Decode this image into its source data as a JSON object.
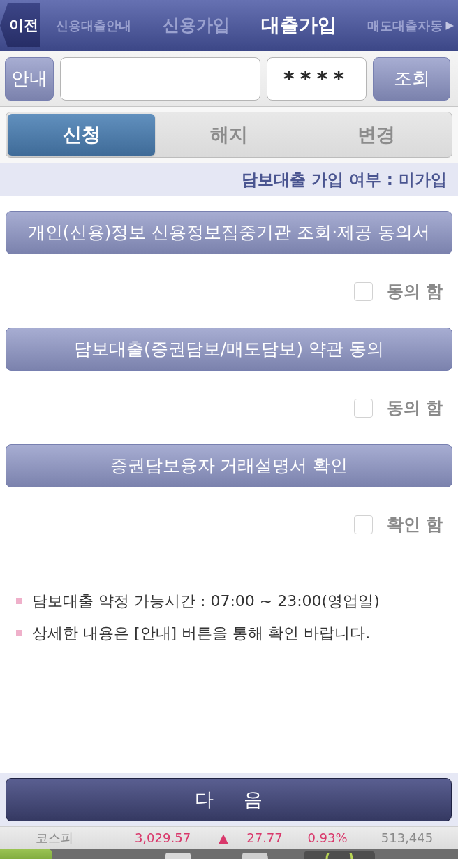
{
  "header": {
    "back_button": "이전",
    "tabs": [
      {
        "label": "신용대출안내",
        "selected": false
      },
      {
        "label": "신용가입",
        "selected": false
      },
      {
        "label": "대출가입",
        "selected": true
      },
      {
        "label": "매도대출자동",
        "selected": false
      }
    ],
    "more_arrow": "▶"
  },
  "lookup": {
    "info_button": "안내",
    "password_field": {
      "value": "****"
    },
    "search_button": "조회"
  },
  "segments": [
    {
      "label": "신청",
      "selected": true
    },
    {
      "label": "해지",
      "selected": false
    },
    {
      "label": "변경",
      "selected": false
    }
  ],
  "status_line": "담보대출 가입 여부 : 미가입",
  "agreements": [
    {
      "button": "개인(신용)정보 신용정보집중기관 조회·제공 동의서",
      "check_label": "동의 함",
      "checked": false
    },
    {
      "button": "담보대출(증권담보/매도담보) 약관 동의",
      "check_label": "동의 함",
      "checked": false
    },
    {
      "button": "증권담보융자 거래설명서 확인",
      "check_label": "확인 함",
      "checked": false
    }
  ],
  "notes": [
    "담보대출 약정 가능시간 : 07:00 ~ 23:00(영업일)",
    "상세한 내용은 [안내] 버튼을 통해 확인 바랍니다."
  ],
  "next_button": "다 음",
  "ticker": [
    {
      "text": "코스피",
      "color": "#8a8a8a"
    },
    {
      "text": "3,029.57",
      "color": "#d9386b"
    },
    {
      "text": "▲",
      "color": "#d9386b"
    },
    {
      "text": "27.77",
      "color": "#d9386b"
    },
    {
      "text": "0.93%",
      "color": "#d9386b"
    },
    {
      "text": "513,445",
      "color": "#8a8a8a"
    }
  ]
}
